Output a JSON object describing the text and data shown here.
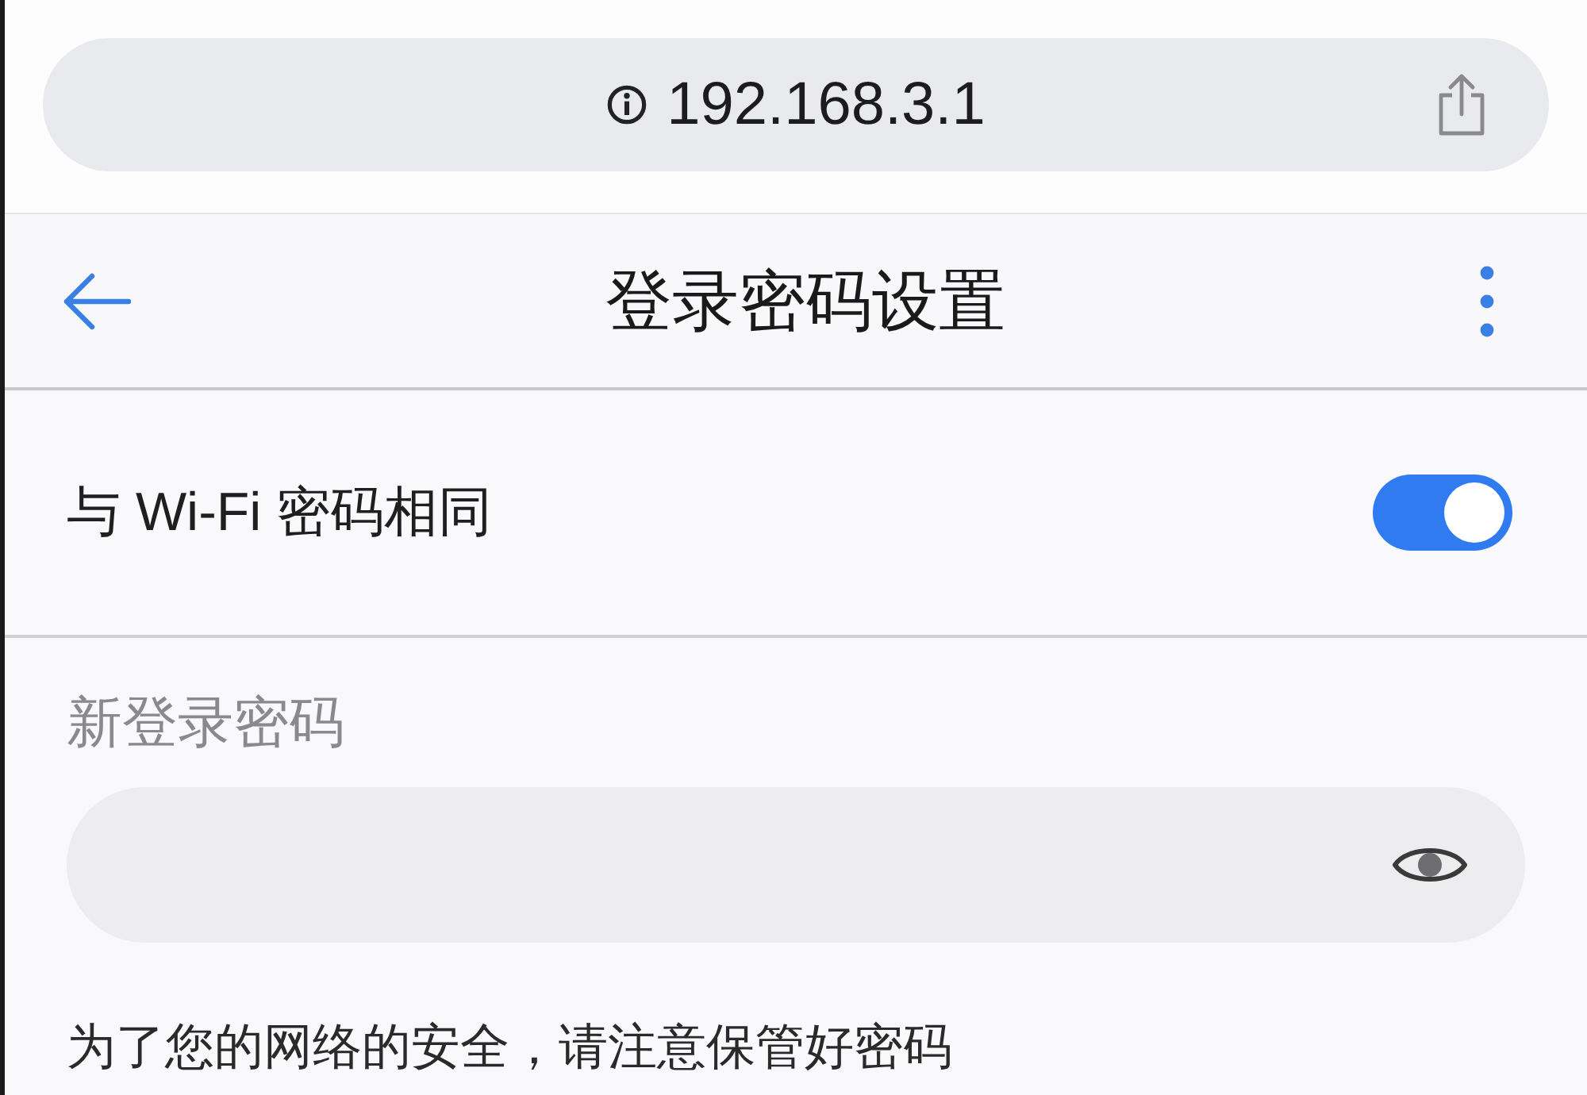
{
  "browser_bar": {
    "url": "192.168.3.1"
  },
  "header": {
    "title": "登录密码设置"
  },
  "same_as_wifi": {
    "label": "与 Wi-Fi 密码相同",
    "on": true
  },
  "new_password": {
    "label": "新登录密码"
  },
  "hint": "为了您的网络的安全，请注意保管好密码"
}
